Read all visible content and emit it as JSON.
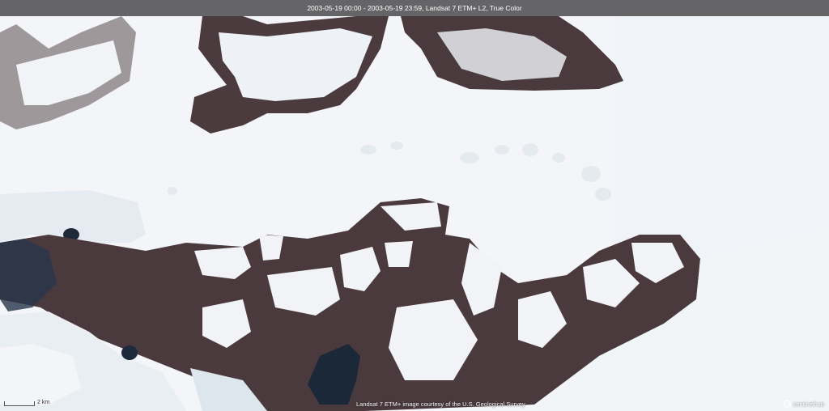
{
  "header": {
    "title": "2003-05-19 00:00 - 2003-05-19 23:59, Landsat 7 ETM+ L2, True Color"
  },
  "scale": {
    "label": "2 km"
  },
  "attribution": {
    "text": "Landsat 7 ETM+ image courtesy of the U.S. Geological Survey"
  },
  "logo": {
    "text": "sentinelhub",
    "icon": "sentinelhub-logo-icon"
  },
  "colors": {
    "ice": "#f4f6f8",
    "rock": "#4a3a3c",
    "water": "#1e2a3a",
    "bar": "#464648"
  }
}
